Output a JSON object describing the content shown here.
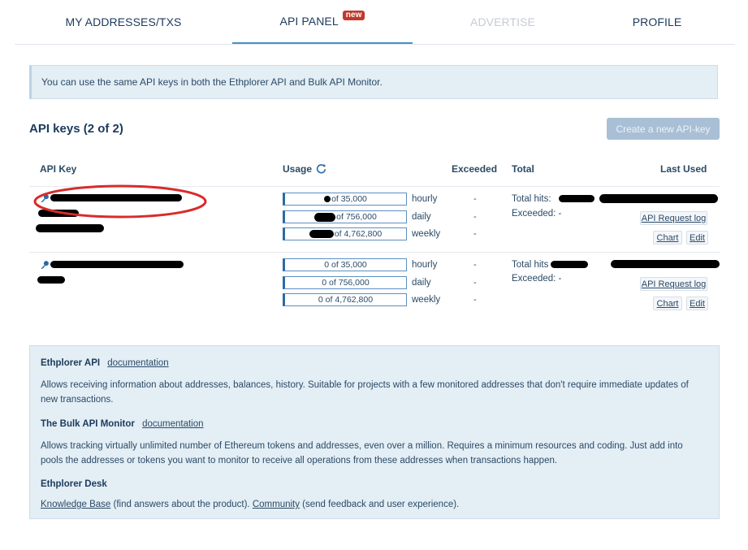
{
  "tabs": [
    {
      "label": "MY ADDRESSES/TXS",
      "state": "normal"
    },
    {
      "label": "API PANEL",
      "badge": "new",
      "state": "active"
    },
    {
      "label": "ADVERTISE",
      "state": "disabled"
    },
    {
      "label": "PROFILE",
      "state": "normal"
    }
  ],
  "banner": "You can use the same API keys in both the Ethplorer API and Bulk API Monitor.",
  "api_keys": {
    "title": "API keys (2 of 2)",
    "create_button": "Create a new API-key",
    "columns": {
      "key": "API Key",
      "usage": "Usage",
      "exceeded": "Exceeded",
      "total": "Total",
      "last_used": "Last Used"
    },
    "rows": [
      {
        "usage": [
          {
            "value": "of 35,000",
            "period": "hourly",
            "exceeded": "-"
          },
          {
            "value": "of 756,000",
            "period": "daily",
            "exceeded": "-"
          },
          {
            "value": "of 4,762,800",
            "period": "weekly",
            "exceeded": "-"
          }
        ],
        "total_hits_label": "Total hits:",
        "exceeded_label": "Exceeded: -",
        "request_log": "API Request log",
        "chart": "Chart",
        "edit": "Edit"
      },
      {
        "usage": [
          {
            "value": "0 of 35,000",
            "period": "hourly",
            "exceeded": "-"
          },
          {
            "value": "0 of 756,000",
            "period": "daily",
            "exceeded": "-"
          },
          {
            "value": "0 of 4,762,800",
            "period": "weekly",
            "exceeded": "-"
          }
        ],
        "total_hits_label": "Total hits",
        "exceeded_label": "Exceeded: -",
        "request_log": "API Request log",
        "chart": "Chart",
        "edit": "Edit"
      }
    ]
  },
  "info": {
    "api_title": "Ethplorer API",
    "api_link": "documentation",
    "api_text": "Allows receiving information about addresses, balances, history. Suitable for projects with a few monitored addresses that don't require immediate updates of new transactions.",
    "bulk_title": "The Bulk API Monitor",
    "bulk_link": "documentation",
    "bulk_text": "Allows tracking virtually unlimited number of Ethereum tokens and addresses, even over a million. Requires a minimum resources and coding. Just add into pools the addresses or tokens you want to monitor to receive all operations from these addresses when transactions happen.",
    "desk_title": "Ethplorer Desk",
    "kb_link": "Knowledge Base",
    "kb_text": " (find answers about the product). ",
    "community_link": "Community",
    "community_text": " (send feedback and user experience)."
  },
  "colors": {
    "accent": "#4a90c8",
    "badge": "#c0392b",
    "panel_bg": "#e3eef5",
    "highlight_ring": "#d92b2b"
  },
  "icons": {
    "key": "key-icon",
    "refresh": "refresh-icon"
  }
}
